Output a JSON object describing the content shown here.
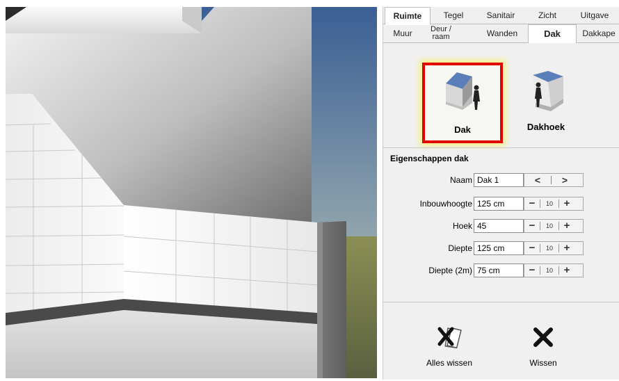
{
  "tabs_main": [
    {
      "label": "Ruimte",
      "active": true
    },
    {
      "label": "Tegel",
      "active": false
    },
    {
      "label": "Sanitair",
      "active": false
    },
    {
      "label": "Zicht",
      "active": false
    },
    {
      "label": "Uitgave",
      "active": false
    }
  ],
  "tabs_sub": [
    {
      "label": "Muur",
      "active": false
    },
    {
      "label": "Deur / raam",
      "active": false
    },
    {
      "label": "Wanden",
      "active": false
    },
    {
      "label": "Dak",
      "active": true
    },
    {
      "label": "Dakkape",
      "active": false
    }
  ],
  "types": {
    "dak_label": "Dak",
    "dakhoek_label": "Dakhoek",
    "selected": "Dak"
  },
  "properties": {
    "title": "Eigenschappen dak",
    "naam": {
      "label": "Naam",
      "value": "Dak 1"
    },
    "inbouwhoogte": {
      "label": "Inbouwhoogte",
      "value": "125 cm",
      "step": "10"
    },
    "hoek": {
      "label": "Hoek",
      "value": "45",
      "step": "10"
    },
    "diepte": {
      "label": "Diepte",
      "value": "125 cm",
      "step": "10"
    },
    "diepte2m": {
      "label": "Diepte (2m)",
      "value": "75 cm",
      "step": "10"
    }
  },
  "actions": {
    "alles_wissen": "Alles wissen",
    "wissen": "Wissen"
  },
  "colors": {
    "selection_border": "#e00000",
    "selection_glow": "#f4f08a",
    "panel_bg": "#f0f0f0"
  }
}
